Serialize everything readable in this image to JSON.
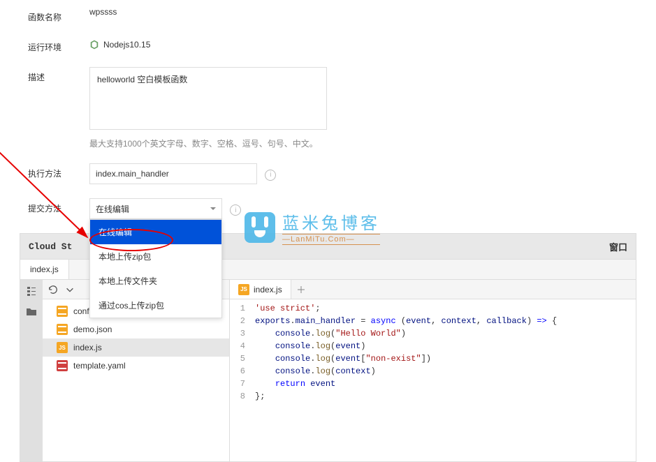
{
  "form": {
    "fn_name_label": "函数名称",
    "fn_name_value": "wpssss",
    "runtime_label": "运行环境",
    "runtime_value": "Nodejs10.15",
    "desc_label": "描述",
    "desc_value": "helloworld 空白模板函数",
    "desc_hint": "最大支持1000个英文字母、数字、空格、逗号、句号、中文。",
    "handler_label": "执行方法",
    "handler_value": "index.main_handler",
    "submit_label": "提交方法",
    "submit_value": "在线编辑"
  },
  "dropdown": {
    "items": [
      "在线编辑",
      "本地上传zip包",
      "本地上传文件夹",
      "通过cos上传zip包"
    ],
    "selected_index": 0
  },
  "editor": {
    "title": "Cloud St",
    "title_right": "窗口",
    "sub_tab": "index.js",
    "files": [
      {
        "name": "config.json",
        "type": "json",
        "active": false
      },
      {
        "name": "demo.json",
        "type": "json",
        "active": false
      },
      {
        "name": "index.js",
        "type": "js",
        "active": true
      },
      {
        "name": "template.yaml",
        "type": "yaml",
        "active": false
      }
    ],
    "code_tab": "index.js",
    "code_lines": [
      {
        "n": 1,
        "html": "<span class='tk-str'>'use strict'</span>;"
      },
      {
        "n": 2,
        "html": "<span class='tk-var'>exports</span>.<span class='tk-var'>main_handler</span> = <span class='tk-kw'>async</span> (<span class='tk-var'>event</span>, <span class='tk-var'>context</span>, <span class='tk-var'>callback</span>) <span class='tk-kw'>=&gt;</span> {"
      },
      {
        "n": 3,
        "html": "    <span class='tk-var'>console</span>.<span class='tk-fn'>log</span>(<span class='tk-str'>\"Hello World\"</span>)"
      },
      {
        "n": 4,
        "html": "    <span class='tk-var'>console</span>.<span class='tk-fn'>log</span>(<span class='tk-var'>event</span>)"
      },
      {
        "n": 5,
        "html": "    <span class='tk-var'>console</span>.<span class='tk-fn'>log</span>(<span class='tk-var'>event</span>[<span class='tk-str'>\"non-exist\"</span>])"
      },
      {
        "n": 6,
        "html": "    <span class='tk-var'>console</span>.<span class='tk-fn'>log</span>(<span class='tk-var'>context</span>)"
      },
      {
        "n": 7,
        "html": "    <span class='tk-kw'>return</span> <span class='tk-var'>event</span>"
      },
      {
        "n": 8,
        "html": "};"
      }
    ]
  },
  "watermark": {
    "cn": "蓝米兔博客",
    "en": "LanMiTu.Com"
  }
}
